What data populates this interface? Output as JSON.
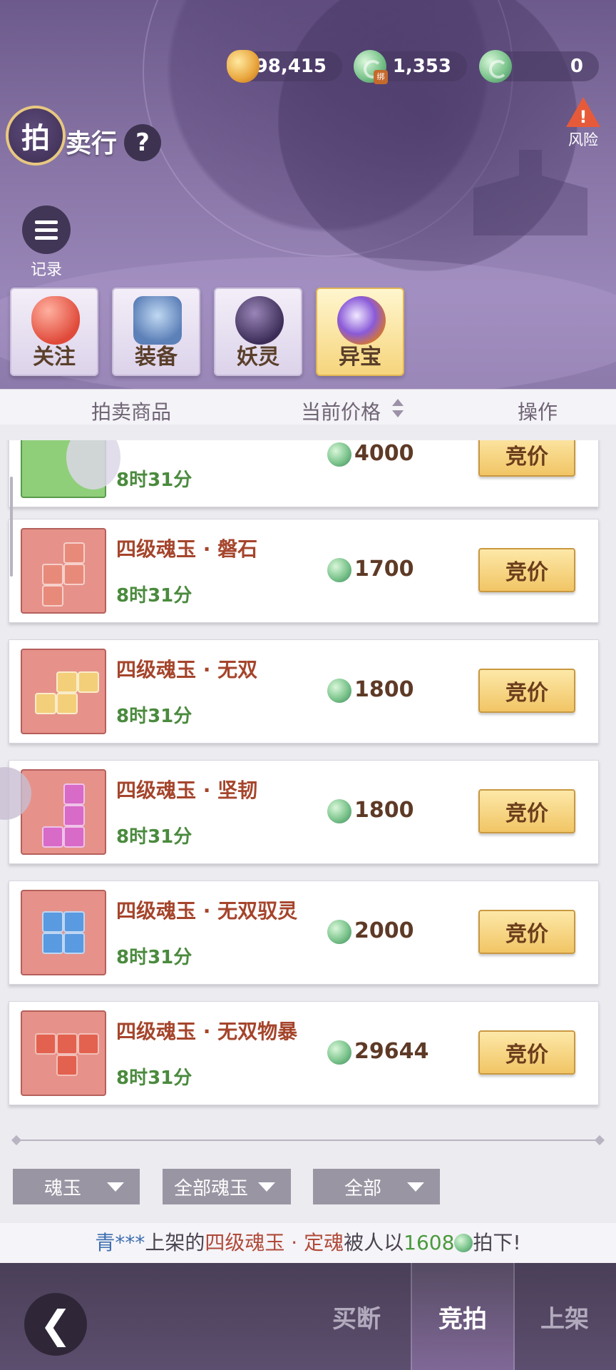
{
  "currency": {
    "gold": "98,415",
    "bound_jade": "1,353",
    "bound_tag": "绑",
    "jade": "0"
  },
  "title": {
    "badge": "拍",
    "rest": "卖行",
    "help": "?"
  },
  "risk": {
    "symbol": "!",
    "label": "风险"
  },
  "record": {
    "label": "记录"
  },
  "categories": [
    {
      "label": "关注"
    },
    {
      "label": "装备"
    },
    {
      "label": "妖灵"
    },
    {
      "label": "异宝"
    }
  ],
  "table_header": {
    "item": "拍卖商品",
    "price": "当前价格",
    "op": "操作"
  },
  "rows": [
    {
      "name": "",
      "time": "8时31分",
      "price": "4000",
      "bid": "竞价"
    },
    {
      "name": "四级魂玉 · 磐石",
      "time": "8时31分",
      "price": "1700",
      "bid": "竞价"
    },
    {
      "name": "四级魂玉 · 无双",
      "time": "8时31分",
      "price": "1800",
      "bid": "竞价"
    },
    {
      "name": "四级魂玉 · 坚韧",
      "time": "8时31分",
      "price": "1800",
      "bid": "竞价"
    },
    {
      "name": "四级魂玉 · 无双驭灵",
      "time": "8时31分",
      "price": "2000",
      "bid": "竞价"
    },
    {
      "name": "四级魂玉 · 无双物暴",
      "time": "8时31分",
      "price": "29644",
      "bid": "竞价"
    }
  ],
  "filters": {
    "type": "魂玉",
    "sub": "全部魂玉",
    "range": "全部"
  },
  "ticker": {
    "user": "青***",
    "text1": "上架的",
    "item": "四级魂玉 · 定魂",
    "text2": "被人以",
    "price": "1608",
    "text3": "拍下!"
  },
  "bottom_tabs": {
    "buy": "买断",
    "auction": "竞拍",
    "list": "上架"
  },
  "colors": {
    "accent_gold": "#f1c565",
    "item_name": "#a5452c",
    "timer_green": "#4a8a3d"
  }
}
